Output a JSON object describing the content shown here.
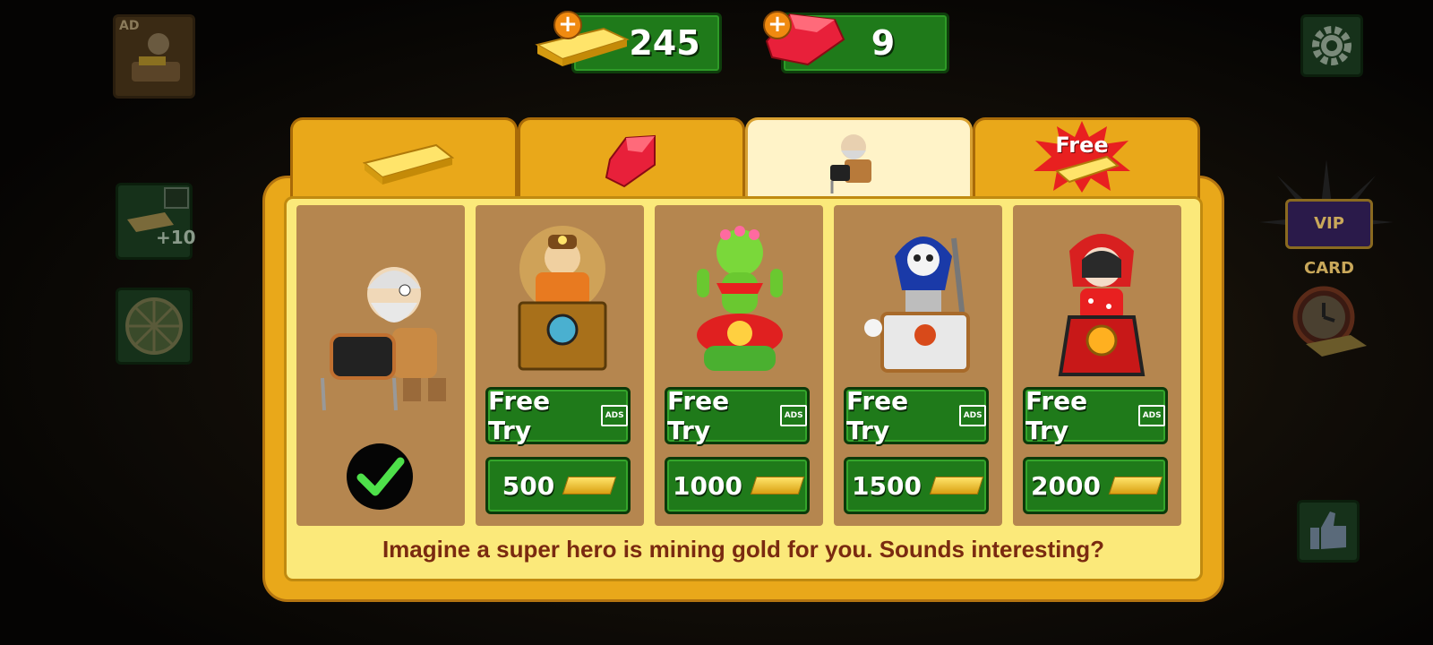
{
  "currency": {
    "gold": "245",
    "ruby": "9"
  },
  "side": {
    "ad_label": "AD",
    "reward_bonus": "+10",
    "vip_label": "VIP CARD"
  },
  "tabs": {
    "free_label": "Free"
  },
  "heroes": [
    {
      "name": "default-miner",
      "selected": true
    },
    {
      "name": "hero-miner",
      "try_label": "Free Try",
      "price": "500"
    },
    {
      "name": "cactus-hero",
      "try_label": "Free Try",
      "price": "1000"
    },
    {
      "name": "skeleton-hero",
      "try_label": "Free Try",
      "price": "1500"
    },
    {
      "name": "girl-hero",
      "try_label": "Free Try",
      "price": "2000"
    }
  ],
  "ad_icon_text": "ADS",
  "description": "Imagine a super hero is mining gold for you. Sounds interesting?",
  "colors": {
    "button_green": "#1f7a1a",
    "panel_orange": "#e9a81a",
    "panel_yellow": "#fbe97a",
    "card_brown": "#b5864f",
    "desc_text": "#7a2a10"
  }
}
